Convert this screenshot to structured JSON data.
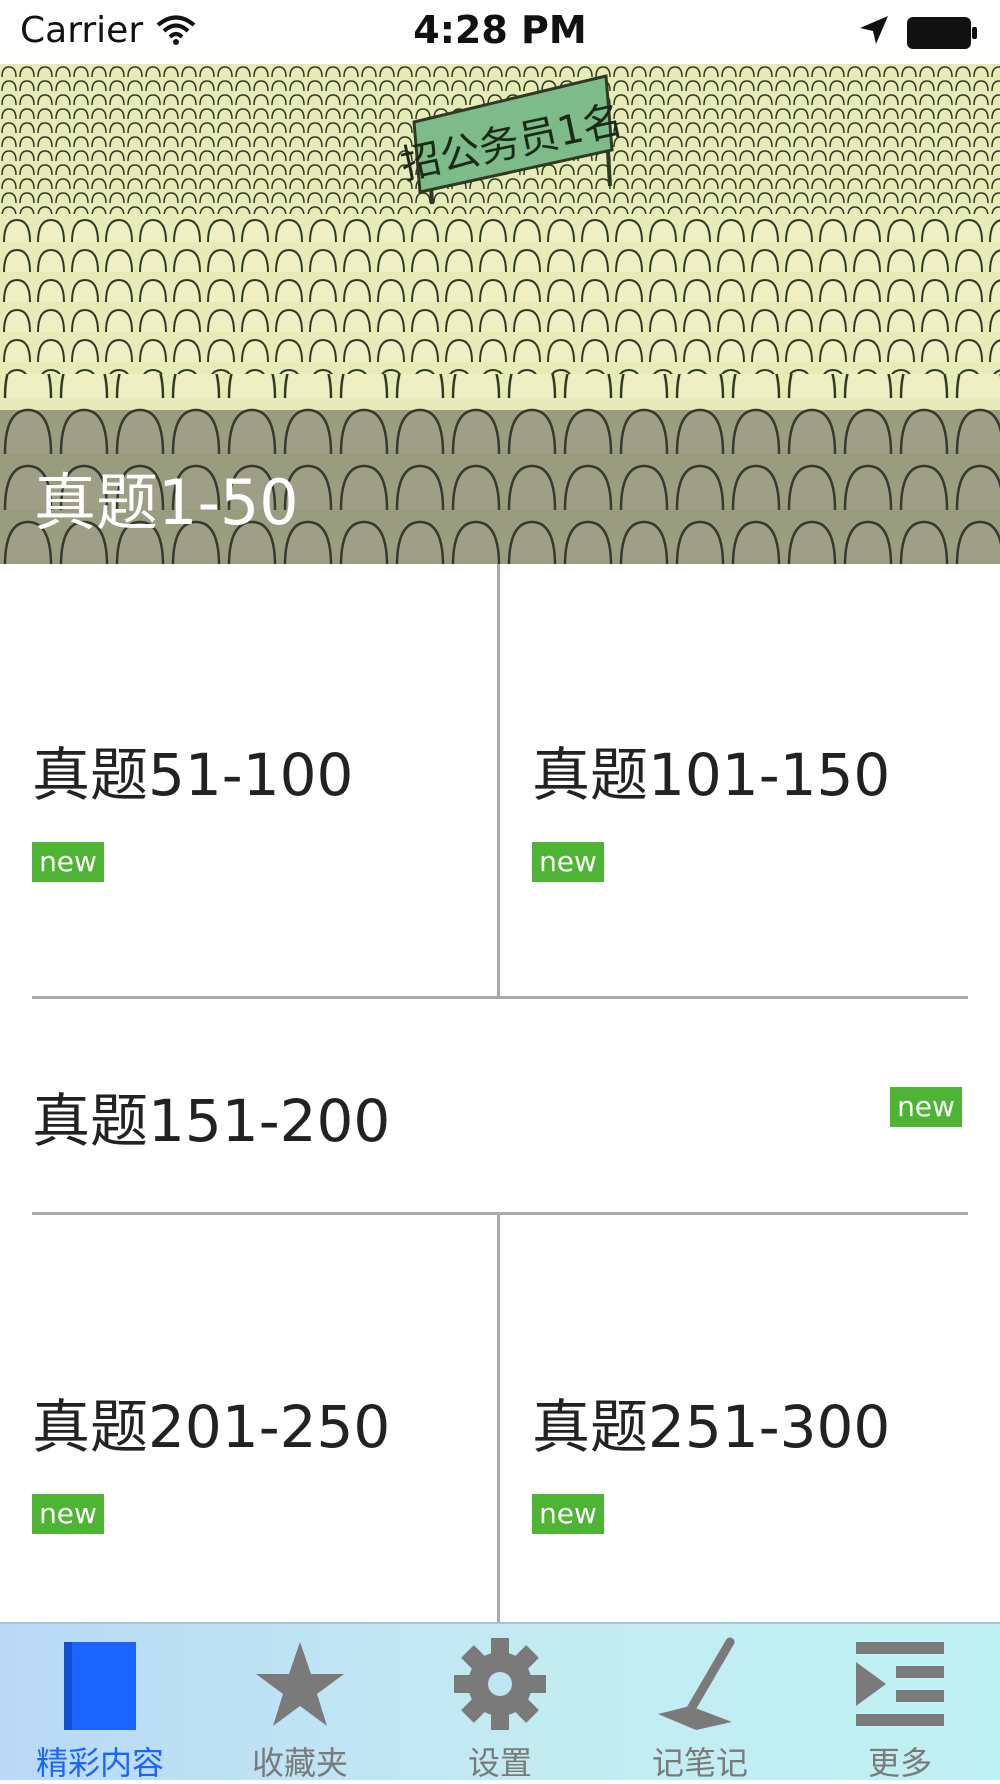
{
  "status_bar": {
    "carrier": "Carrier",
    "time": "4:28 PM"
  },
  "hero": {
    "title": "真题1-50",
    "banner_text": "招公务员1名"
  },
  "cells": [
    {
      "title": "真题51-100",
      "badge": "new"
    },
    {
      "title": "真题101-150",
      "badge": "new"
    },
    {
      "title": "真题151-200",
      "badge": "new"
    },
    {
      "title": "真题201-250",
      "badge": "new"
    },
    {
      "title": "真题251-300",
      "badge": "new"
    }
  ],
  "tab_bar": {
    "tabs": [
      {
        "label": "精彩内容",
        "icon": "book-icon",
        "active": true
      },
      {
        "label": "收藏夹",
        "icon": "star-icon",
        "active": false
      },
      {
        "label": "设置",
        "icon": "gear-icon",
        "active": false
      },
      {
        "label": "记笔记",
        "icon": "pen-icon",
        "active": false
      },
      {
        "label": "更多",
        "icon": "indent-menu-icon",
        "active": false
      }
    ]
  },
  "colors": {
    "badge": "#4db533",
    "active_tab": "#1a64ff",
    "inactive_tab": "#7a7a7a",
    "divider": "#aaaaaa"
  }
}
